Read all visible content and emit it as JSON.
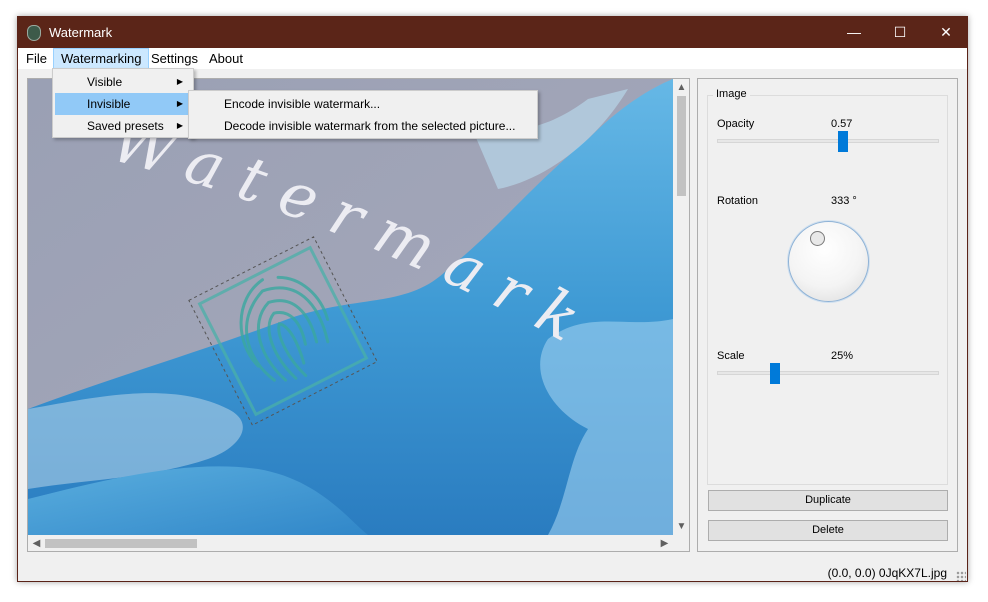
{
  "window": {
    "title": "Watermark",
    "controls": {
      "minimize": "—",
      "maximize": "☐",
      "close": "✕"
    }
  },
  "menubar": {
    "items": [
      {
        "label": "File"
      },
      {
        "label": "Watermarking",
        "active": true
      },
      {
        "label": "Settings"
      },
      {
        "label": "About"
      }
    ]
  },
  "watermarking_menu": {
    "items": [
      {
        "label": "Visible",
        "submenu": true
      },
      {
        "label": "Invisible",
        "submenu": true,
        "highlighted": true
      },
      {
        "label": "Saved presets",
        "submenu": true
      }
    ]
  },
  "invisible_submenu": {
    "items": [
      {
        "label": "Encode invisible watermark..."
      },
      {
        "label": "Decode invisible watermark from the selected picture..."
      }
    ]
  },
  "canvas": {
    "watermark_text": "Watermark",
    "icon": "fingerprint-icon"
  },
  "panel": {
    "group_title": "Image",
    "opacity": {
      "label": "Opacity",
      "value": "0.57",
      "level": 0.57
    },
    "rotation": {
      "label": "Rotation",
      "value": "333 °",
      "degrees": 333
    },
    "scale": {
      "label": "Scale",
      "value": "25%",
      "level": 0.25
    },
    "duplicate_label": "Duplicate",
    "delete_label": "Delete"
  },
  "status": {
    "text": "(0.0, 0.0)  0JqKX7L.jpg"
  },
  "colors": {
    "titlebar": "#5b2518",
    "accent": "#007ad9",
    "menu_highlight": "#91c9f7"
  }
}
